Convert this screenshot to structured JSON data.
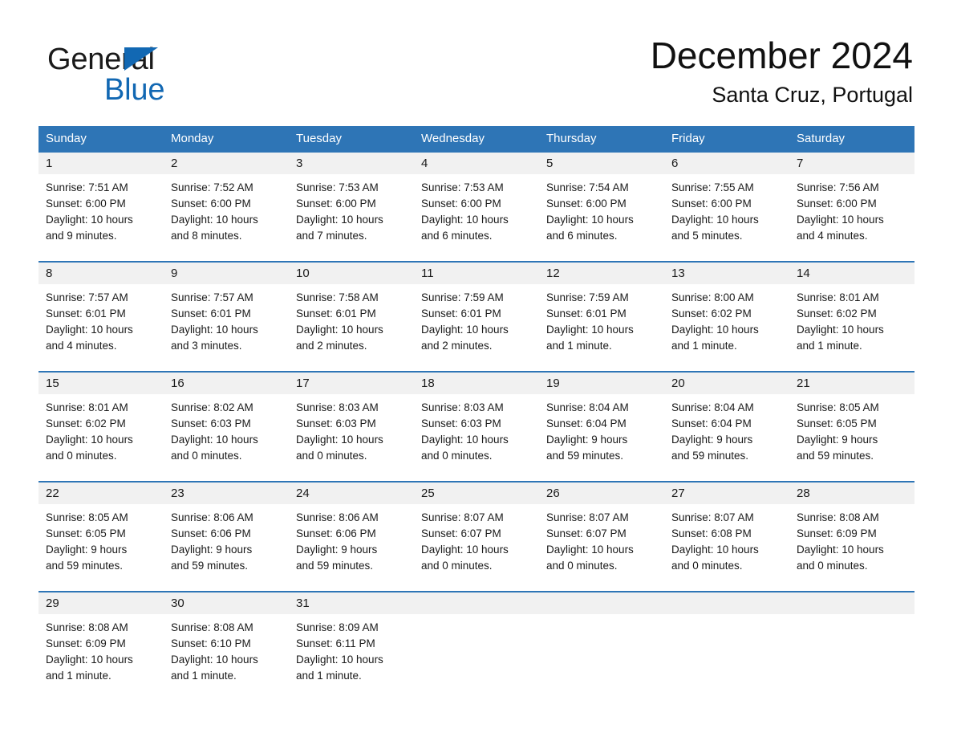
{
  "brand": {
    "name_part1": "General",
    "name_part2": "Blue",
    "triangle_color": "#1268b3"
  },
  "header": {
    "month_title": "December 2024",
    "location": "Santa Cruz, Portugal"
  },
  "colors": {
    "header_blue": "#2e75b6",
    "daynum_band": "#f1f1f1",
    "text": "#1a1a1a",
    "brand_blue": "#1268b3"
  },
  "weekdays": [
    "Sunday",
    "Monday",
    "Tuesday",
    "Wednesday",
    "Thursday",
    "Friday",
    "Saturday"
  ],
  "weeks": [
    [
      {
        "day": "1",
        "sunrise": "Sunrise: 7:51 AM",
        "sunset": "Sunset: 6:00 PM",
        "daylight1": "Daylight: 10 hours",
        "daylight2": "and 9 minutes."
      },
      {
        "day": "2",
        "sunrise": "Sunrise: 7:52 AM",
        "sunset": "Sunset: 6:00 PM",
        "daylight1": "Daylight: 10 hours",
        "daylight2": "and 8 minutes."
      },
      {
        "day": "3",
        "sunrise": "Sunrise: 7:53 AM",
        "sunset": "Sunset: 6:00 PM",
        "daylight1": "Daylight: 10 hours",
        "daylight2": "and 7 minutes."
      },
      {
        "day": "4",
        "sunrise": "Sunrise: 7:53 AM",
        "sunset": "Sunset: 6:00 PM",
        "daylight1": "Daylight: 10 hours",
        "daylight2": "and 6 minutes."
      },
      {
        "day": "5",
        "sunrise": "Sunrise: 7:54 AM",
        "sunset": "Sunset: 6:00 PM",
        "daylight1": "Daylight: 10 hours",
        "daylight2": "and 6 minutes."
      },
      {
        "day": "6",
        "sunrise": "Sunrise: 7:55 AM",
        "sunset": "Sunset: 6:00 PM",
        "daylight1": "Daylight: 10 hours",
        "daylight2": "and 5 minutes."
      },
      {
        "day": "7",
        "sunrise": "Sunrise: 7:56 AM",
        "sunset": "Sunset: 6:00 PM",
        "daylight1": "Daylight: 10 hours",
        "daylight2": "and 4 minutes."
      }
    ],
    [
      {
        "day": "8",
        "sunrise": "Sunrise: 7:57 AM",
        "sunset": "Sunset: 6:01 PM",
        "daylight1": "Daylight: 10 hours",
        "daylight2": "and 4 minutes."
      },
      {
        "day": "9",
        "sunrise": "Sunrise: 7:57 AM",
        "sunset": "Sunset: 6:01 PM",
        "daylight1": "Daylight: 10 hours",
        "daylight2": "and 3 minutes."
      },
      {
        "day": "10",
        "sunrise": "Sunrise: 7:58 AM",
        "sunset": "Sunset: 6:01 PM",
        "daylight1": "Daylight: 10 hours",
        "daylight2": "and 2 minutes."
      },
      {
        "day": "11",
        "sunrise": "Sunrise: 7:59 AM",
        "sunset": "Sunset: 6:01 PM",
        "daylight1": "Daylight: 10 hours",
        "daylight2": "and 2 minutes."
      },
      {
        "day": "12",
        "sunrise": "Sunrise: 7:59 AM",
        "sunset": "Sunset: 6:01 PM",
        "daylight1": "Daylight: 10 hours",
        "daylight2": "and 1 minute."
      },
      {
        "day": "13",
        "sunrise": "Sunrise: 8:00 AM",
        "sunset": "Sunset: 6:02 PM",
        "daylight1": "Daylight: 10 hours",
        "daylight2": "and 1 minute."
      },
      {
        "day": "14",
        "sunrise": "Sunrise: 8:01 AM",
        "sunset": "Sunset: 6:02 PM",
        "daylight1": "Daylight: 10 hours",
        "daylight2": "and 1 minute."
      }
    ],
    [
      {
        "day": "15",
        "sunrise": "Sunrise: 8:01 AM",
        "sunset": "Sunset: 6:02 PM",
        "daylight1": "Daylight: 10 hours",
        "daylight2": "and 0 minutes."
      },
      {
        "day": "16",
        "sunrise": "Sunrise: 8:02 AM",
        "sunset": "Sunset: 6:03 PM",
        "daylight1": "Daylight: 10 hours",
        "daylight2": "and 0 minutes."
      },
      {
        "day": "17",
        "sunrise": "Sunrise: 8:03 AM",
        "sunset": "Sunset: 6:03 PM",
        "daylight1": "Daylight: 10 hours",
        "daylight2": "and 0 minutes."
      },
      {
        "day": "18",
        "sunrise": "Sunrise: 8:03 AM",
        "sunset": "Sunset: 6:03 PM",
        "daylight1": "Daylight: 10 hours",
        "daylight2": "and 0 minutes."
      },
      {
        "day": "19",
        "sunrise": "Sunrise: 8:04 AM",
        "sunset": "Sunset: 6:04 PM",
        "daylight1": "Daylight: 9 hours",
        "daylight2": "and 59 minutes."
      },
      {
        "day": "20",
        "sunrise": "Sunrise: 8:04 AM",
        "sunset": "Sunset: 6:04 PM",
        "daylight1": "Daylight: 9 hours",
        "daylight2": "and 59 minutes."
      },
      {
        "day": "21",
        "sunrise": "Sunrise: 8:05 AM",
        "sunset": "Sunset: 6:05 PM",
        "daylight1": "Daylight: 9 hours",
        "daylight2": "and 59 minutes."
      }
    ],
    [
      {
        "day": "22",
        "sunrise": "Sunrise: 8:05 AM",
        "sunset": "Sunset: 6:05 PM",
        "daylight1": "Daylight: 9 hours",
        "daylight2": "and 59 minutes."
      },
      {
        "day": "23",
        "sunrise": "Sunrise: 8:06 AM",
        "sunset": "Sunset: 6:06 PM",
        "daylight1": "Daylight: 9 hours",
        "daylight2": "and 59 minutes."
      },
      {
        "day": "24",
        "sunrise": "Sunrise: 8:06 AM",
        "sunset": "Sunset: 6:06 PM",
        "daylight1": "Daylight: 9 hours",
        "daylight2": "and 59 minutes."
      },
      {
        "day": "25",
        "sunrise": "Sunrise: 8:07 AM",
        "sunset": "Sunset: 6:07 PM",
        "daylight1": "Daylight: 10 hours",
        "daylight2": "and 0 minutes."
      },
      {
        "day": "26",
        "sunrise": "Sunrise: 8:07 AM",
        "sunset": "Sunset: 6:07 PM",
        "daylight1": "Daylight: 10 hours",
        "daylight2": "and 0 minutes."
      },
      {
        "day": "27",
        "sunrise": "Sunrise: 8:07 AM",
        "sunset": "Sunset: 6:08 PM",
        "daylight1": "Daylight: 10 hours",
        "daylight2": "and 0 minutes."
      },
      {
        "day": "28",
        "sunrise": "Sunrise: 8:08 AM",
        "sunset": "Sunset: 6:09 PM",
        "daylight1": "Daylight: 10 hours",
        "daylight2": "and 0 minutes."
      }
    ],
    [
      {
        "day": "29",
        "sunrise": "Sunrise: 8:08 AM",
        "sunset": "Sunset: 6:09 PM",
        "daylight1": "Daylight: 10 hours",
        "daylight2": "and 1 minute."
      },
      {
        "day": "30",
        "sunrise": "Sunrise: 8:08 AM",
        "sunset": "Sunset: 6:10 PM",
        "daylight1": "Daylight: 10 hours",
        "daylight2": "and 1 minute."
      },
      {
        "day": "31",
        "sunrise": "Sunrise: 8:09 AM",
        "sunset": "Sunset: 6:11 PM",
        "daylight1": "Daylight: 10 hours",
        "daylight2": "and 1 minute."
      },
      {
        "day": "",
        "sunrise": "",
        "sunset": "",
        "daylight1": "",
        "daylight2": ""
      },
      {
        "day": "",
        "sunrise": "",
        "sunset": "",
        "daylight1": "",
        "daylight2": ""
      },
      {
        "day": "",
        "sunrise": "",
        "sunset": "",
        "daylight1": "",
        "daylight2": ""
      },
      {
        "day": "",
        "sunrise": "",
        "sunset": "",
        "daylight1": "",
        "daylight2": ""
      }
    ]
  ]
}
